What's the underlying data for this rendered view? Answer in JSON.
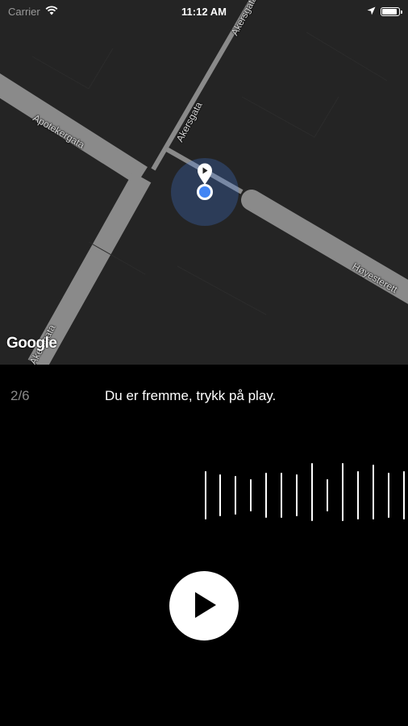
{
  "status_bar": {
    "carrier": "Carrier",
    "time": "11:12 AM",
    "battery_level": 0.95,
    "icons": [
      "wifi-icon",
      "location-arrow-icon",
      "battery-icon"
    ]
  },
  "map": {
    "streets": [
      "Akersgata",
      "Akersgata",
      "Apotekergata",
      "Høyesterett",
      "Akersgata"
    ],
    "attribution": "Google",
    "colors": {
      "background": "#242424",
      "road": "#8a8a8a",
      "location": "#4285f4"
    }
  },
  "player": {
    "progress": "2/6",
    "instruction": "Du er fremme, trykk på play.",
    "play_icon": "play-icon",
    "colors": {
      "background": "#000000",
      "accent": "#ffffff"
    }
  }
}
